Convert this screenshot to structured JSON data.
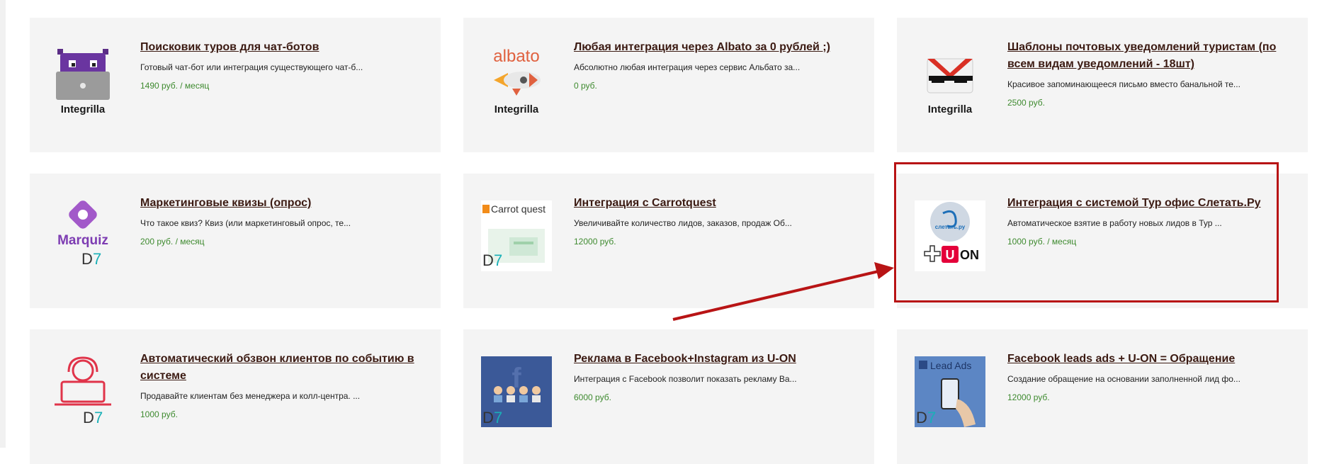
{
  "cards": [
    {
      "title": "Поисковик туров для чат-ботов",
      "desc": "Готовый чат-бот или интеграция существующего чат-б...",
      "price": "1490 руб. / месяц",
      "logo_text": "Integrilla",
      "icon": "monster-laptop-icon"
    },
    {
      "title": "Любая интеграция через Albato за 0 рублей ;)",
      "desc": "Абсолютно любая интеграция через сервис Альбато за...",
      "price": "0 руб.",
      "logo_text": "Integrilla",
      "logo_brand": "albato",
      "icon": "rocket-icon"
    },
    {
      "title": "Шаблоны почтовых уведомлений туристам (по всем видам уведомлений - 18шт)",
      "desc": "Красивое запоминающееся письмо вместо банальной те...",
      "price": "2500 руб.",
      "logo_text": "Integrilla",
      "icon": "gmail-sunglasses-icon"
    },
    {
      "title": "Маркетинговые квизы (опрос)",
      "desc": "Что такое квиз? Квиз (или маркетинговый опрос, те...",
      "price": "200 руб. / месяц",
      "logo_brand": "Marquiz",
      "logo_d": "D",
      "logo_seven": "7",
      "icon": "marquiz-icon"
    },
    {
      "title": "Интеграция с Carrotquest",
      "desc": "Увеличивайте количество лидов, заказов, продаж Об...",
      "price": "12000 руб.",
      "logo_brand": "Carrot quest",
      "logo_d": "D",
      "logo_seven": "7",
      "icon": "carrot-quest-icon"
    },
    {
      "title": "Интеграция с системой Тур офис Слетать.Ру",
      "desc": "Автоматическое взятие в работу новых лидов в Тур ...",
      "price": "1000 руб. / месяц",
      "logo_brand": "слетать.ру",
      "logo_u": "U",
      "logo_on": "ON",
      "icon": "sletat-uon-icon"
    },
    {
      "title": "Автоматический обзвон клиентов по событию в системе",
      "desc": "Продавайте клиентам без менеджера и колл-центра. ...",
      "price": "1000 руб.",
      "logo_d": "D",
      "logo_seven": "7",
      "icon": "operator-headset-icon"
    },
    {
      "title": "Реклама в Facebook+Instagram из U-ON",
      "desc": "Интеграция с Facebook позволит показать рекламу Ва...",
      "price": "6000 руб.",
      "logo_d": "D",
      "logo_seven": "7",
      "icon": "facebook-people-icon"
    },
    {
      "title": "Facebook leads ads + U-ON = Обращение",
      "desc": "Создание обращение на основании заполненной лид фо...",
      "price": "12000 руб.",
      "logo_brand": "Lead Ads",
      "logo_d": "D",
      "logo_seven": "7",
      "icon": "facebook-lead-ads-icon"
    }
  ],
  "colors": {
    "card_bg": "#f4f4f4",
    "title": "#3b1a12",
    "price": "#3e8a2f",
    "highlight": "#b81415"
  }
}
